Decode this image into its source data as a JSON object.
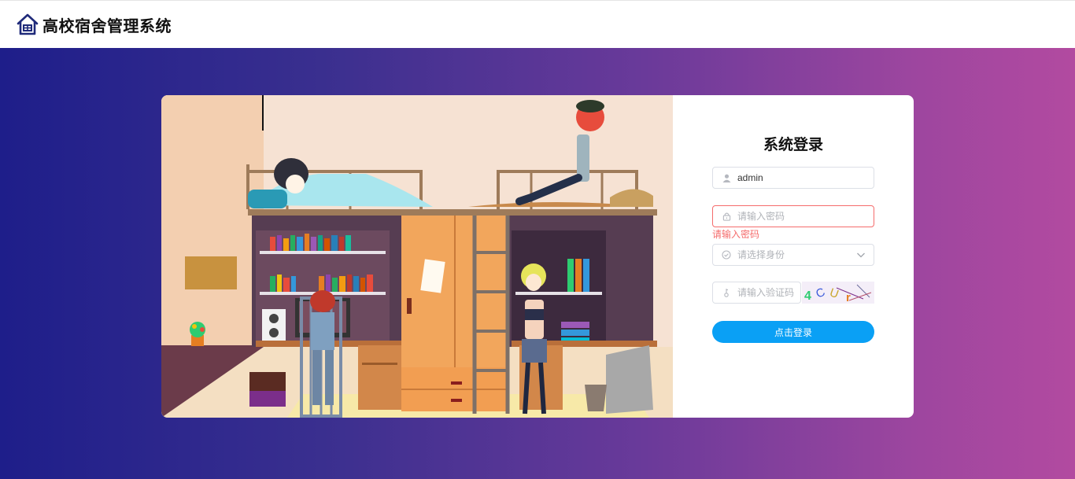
{
  "app": {
    "title": "高校宿舍管理系统",
    "logo_icon": "house-icon"
  },
  "login": {
    "heading": "系统登录",
    "username": {
      "value": "admin",
      "icon": "user-icon"
    },
    "password": {
      "value": "",
      "placeholder": "请输入密码",
      "icon": "lock-icon",
      "error": "请输入密码"
    },
    "role": {
      "value": "",
      "placeholder": "请选择身份",
      "icon": "check-circle-icon"
    },
    "captcha": {
      "value": "",
      "placeholder": "请输入验证码",
      "icon": "key-icon",
      "image_text": "4CUr"
    },
    "submit_label": "点击登录"
  },
  "colors": {
    "accent": "#0aa0f5",
    "error": "#f56c6c",
    "gradient_start": "#1e1e8a",
    "gradient_end": "#b24aa0"
  }
}
